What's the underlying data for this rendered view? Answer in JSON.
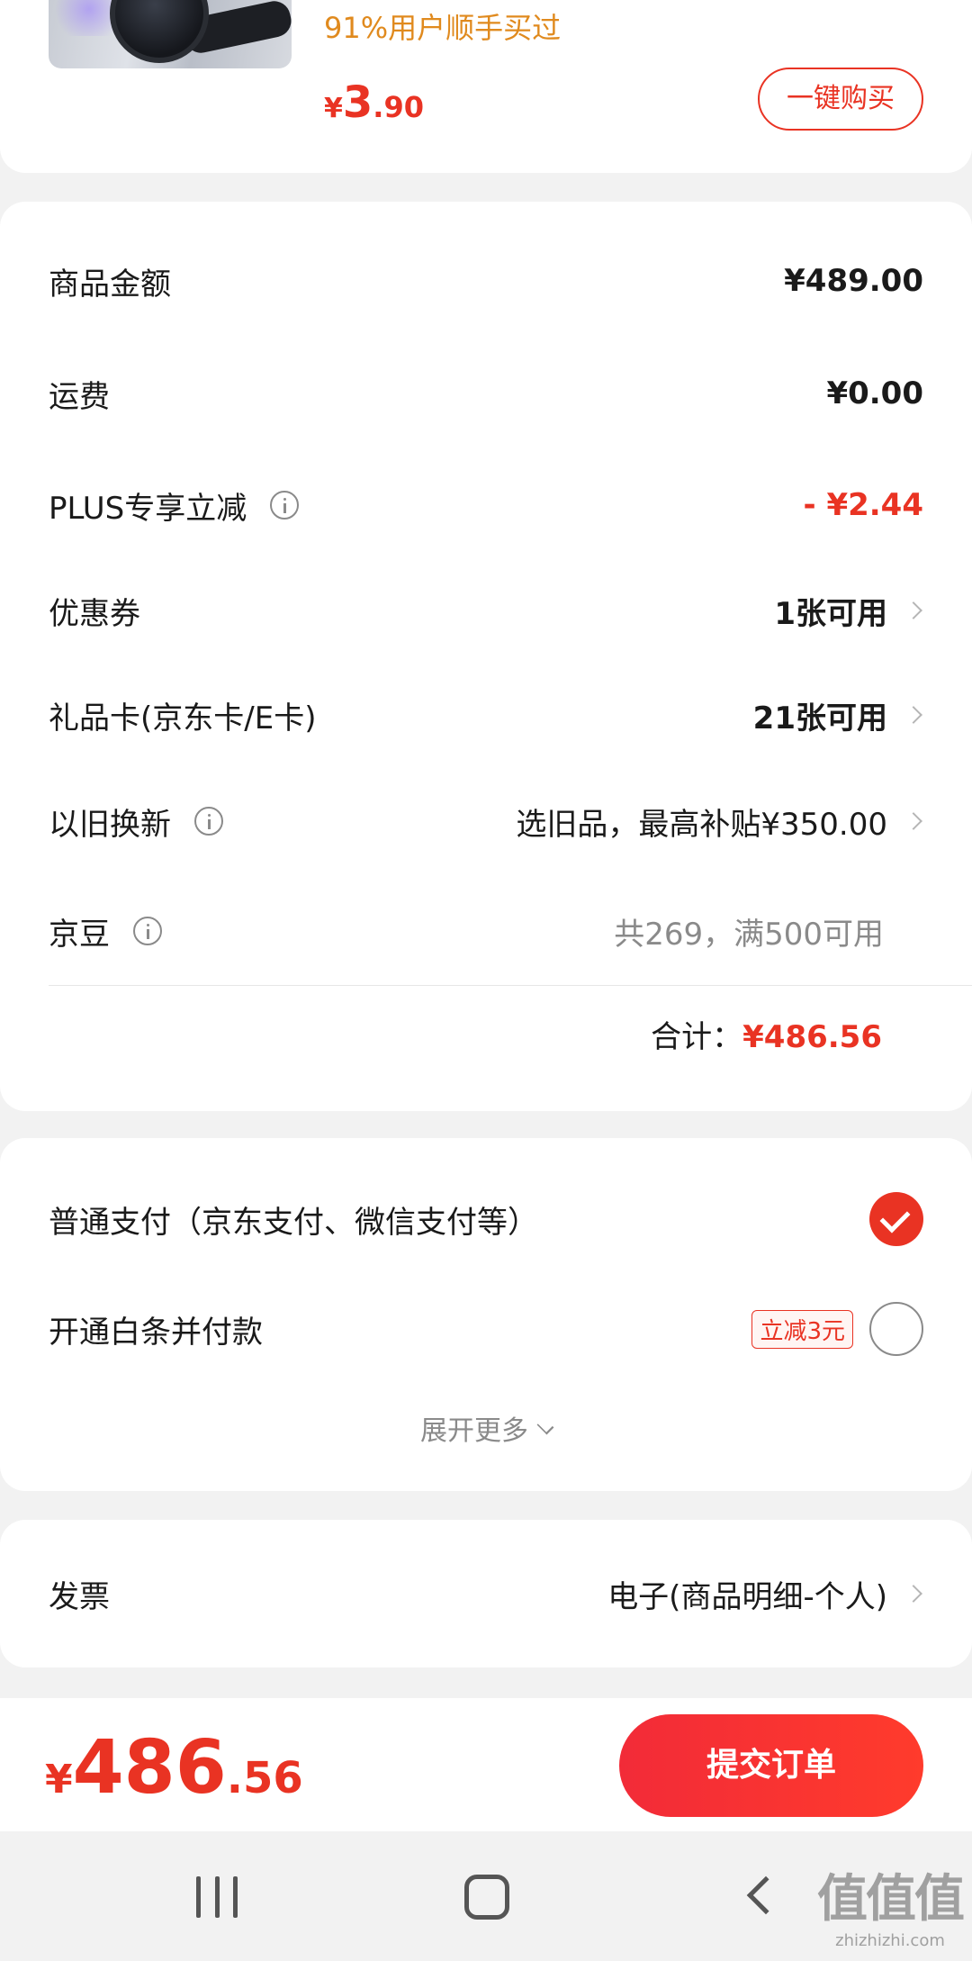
{
  "product": {
    "bought_text": "91%用户顺手买过",
    "price_yen": "¥",
    "price_int": "3",
    "price_dec": ".90",
    "buy_button": "一键购买"
  },
  "summary": {
    "rows": [
      {
        "label": "商品金额",
        "value": "¥489.00"
      },
      {
        "label": "运费",
        "value": "¥0.00"
      },
      {
        "label": "PLUS专享立减",
        "value": "- ¥2.44"
      },
      {
        "label": "优惠券",
        "value": "1张可用"
      },
      {
        "label": "礼品卡(京东卡/E卡)",
        "value": "21张可用"
      },
      {
        "label": "以旧换新",
        "value": "选旧品，最高补贴¥350.00"
      },
      {
        "label": "京豆",
        "value": "共269，满500可用"
      }
    ],
    "total_label": "合计：",
    "total_value": "¥486.56"
  },
  "payment": {
    "options": [
      {
        "label": "普通支付（京东支付、微信支付等）",
        "selected": true
      },
      {
        "label": "开通白条并付款",
        "promo": "立减3元",
        "selected": false
      }
    ],
    "expand_label": "展开更多"
  },
  "invoice": {
    "label": "发票",
    "value": "电子(商品明细-个人)"
  },
  "bottom": {
    "price_yen": "¥",
    "price_int": "486",
    "price_dec": ".56",
    "submit_label": "提交订单"
  },
  "watermark": {
    "logo": "值值值",
    "url": "zhizhizhi.com"
  },
  "colors": {
    "accent": "#e93323",
    "promo_orange": "#e08a1e",
    "background": "#f2f2f2"
  },
  "icons": [
    "info-icon",
    "chevron-right-icon",
    "check-icon",
    "chevron-down-icon",
    "nav-recent-icon",
    "nav-home-icon",
    "nav-back-icon"
  ]
}
